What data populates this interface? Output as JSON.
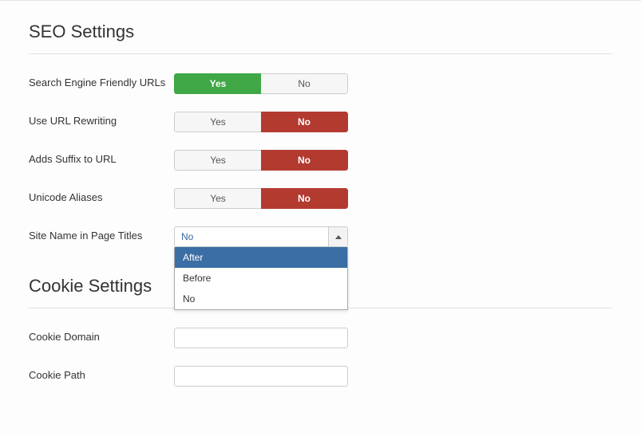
{
  "seo": {
    "title": "SEO Settings",
    "fields": {
      "sef": {
        "label": "Search Engine Friendly URLs",
        "yes": "Yes",
        "no": "No",
        "value": "yes"
      },
      "rewrite": {
        "label": "Use URL Rewriting",
        "yes": "Yes",
        "no": "No",
        "value": "no"
      },
      "suffix": {
        "label": "Adds Suffix to URL",
        "yes": "Yes",
        "no": "No",
        "value": "no"
      },
      "unicode": {
        "label": "Unicode Aliases",
        "yes": "Yes",
        "no": "No",
        "value": "no"
      },
      "sitename": {
        "label": "Site Name in Page Titles",
        "selected": "No",
        "options": [
          "After",
          "Before",
          "No"
        ],
        "highlighted": "After"
      }
    }
  },
  "cookie": {
    "title": "Cookie Settings",
    "fields": {
      "domain": {
        "label": "Cookie Domain",
        "value": ""
      },
      "path": {
        "label": "Cookie Path",
        "value": ""
      }
    }
  }
}
